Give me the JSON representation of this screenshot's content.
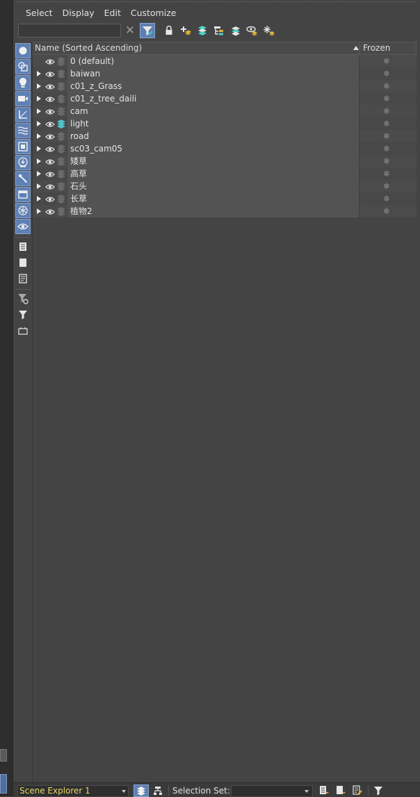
{
  "menu": [
    "Select",
    "Display",
    "Edit",
    "Customize"
  ],
  "toolbar": {
    "search_value": "",
    "clear_glyph": "✕",
    "buttons": [
      "filter-active-icon",
      "lock-icon",
      "new-layer-icon",
      "layers-icon",
      "hierarchy-icon",
      "layer-stack-icon",
      "layer-props-icon",
      "freeze-icon"
    ]
  },
  "left_toolbar": [
    "geometry-icon",
    "shapes-icon",
    "lights-icon",
    "cameras-icon",
    "helpers-icon",
    "space-warps-icon",
    "groups-icon",
    "xrefs-icon",
    "bones-icon",
    "containers-icon",
    "frozen-icon",
    "hidden-icon",
    "display-all-icon",
    "display-none-icon",
    "invert-icon",
    "filter-settings-icon",
    "filter-icon",
    "find-icon"
  ],
  "table": {
    "col_name": "Name (Sorted Ascending)",
    "col_frozen": "Frozen",
    "frozen_glyph": "❄",
    "rows": [
      {
        "name": "0 (default)",
        "expandable": false,
        "active_layer": false
      },
      {
        "name": "baiwan",
        "expandable": true,
        "active_layer": false
      },
      {
        "name": "c01_z_Grass",
        "expandable": true,
        "active_layer": false
      },
      {
        "name": "c01_z_tree_daili",
        "expandable": true,
        "active_layer": false
      },
      {
        "name": "cam",
        "expandable": true,
        "active_layer": false
      },
      {
        "name": "light",
        "expandable": true,
        "active_layer": true
      },
      {
        "name": "road",
        "expandable": true,
        "active_layer": false
      },
      {
        "name": "sc03_cam05",
        "expandable": true,
        "active_layer": false
      },
      {
        "name": "矮草",
        "expandable": true,
        "active_layer": false
      },
      {
        "name": "高草",
        "expandable": true,
        "active_layer": false
      },
      {
        "name": "石头",
        "expandable": true,
        "active_layer": false
      },
      {
        "name": "长草",
        "expandable": true,
        "active_layer": false
      },
      {
        "name": "植物2",
        "expandable": true,
        "active_layer": false
      }
    ]
  },
  "statusbar": {
    "explorer_name": "Scene Explorer 1",
    "selection_set_label": "Selection Set:",
    "selection_set_value": ""
  },
  "colors": {
    "active_button": "#5e7fb1",
    "active_layer_icon": "#4fc4c9",
    "explorer_name_text": "#e8d86a"
  }
}
